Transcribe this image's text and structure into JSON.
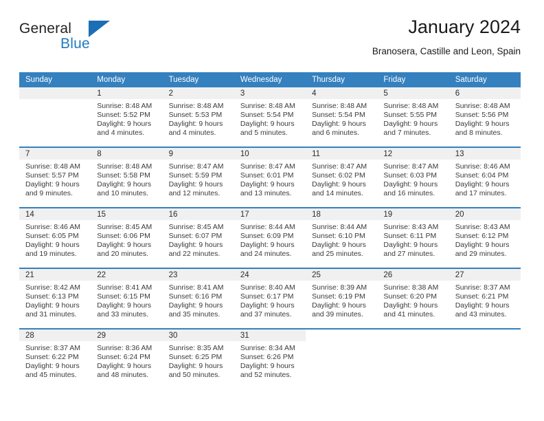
{
  "brand": {
    "name_part1": "General",
    "name_part2": "Blue",
    "accent_color": "#1a6fb5"
  },
  "header": {
    "title": "January 2024",
    "subtitle": "Branosera, Castille and Leon, Spain"
  },
  "theme": {
    "header_blue": "#3580be",
    "day_band_gray": "#f0f0f0",
    "text_color": "#3a3a3a"
  },
  "weekday_headers": [
    "Sunday",
    "Monday",
    "Tuesday",
    "Wednesday",
    "Thursday",
    "Friday",
    "Saturday"
  ],
  "weeks": [
    [
      {
        "day": "",
        "sunrise": "",
        "sunset": "",
        "daylight_line1": "",
        "daylight_line2": "",
        "empty": true
      },
      {
        "day": "1",
        "sunrise": "Sunrise: 8:48 AM",
        "sunset": "Sunset: 5:52 PM",
        "daylight_line1": "Daylight: 9 hours",
        "daylight_line2": "and 4 minutes."
      },
      {
        "day": "2",
        "sunrise": "Sunrise: 8:48 AM",
        "sunset": "Sunset: 5:53 PM",
        "daylight_line1": "Daylight: 9 hours",
        "daylight_line2": "and 4 minutes."
      },
      {
        "day": "3",
        "sunrise": "Sunrise: 8:48 AM",
        "sunset": "Sunset: 5:54 PM",
        "daylight_line1": "Daylight: 9 hours",
        "daylight_line2": "and 5 minutes."
      },
      {
        "day": "4",
        "sunrise": "Sunrise: 8:48 AM",
        "sunset": "Sunset: 5:54 PM",
        "daylight_line1": "Daylight: 9 hours",
        "daylight_line2": "and 6 minutes."
      },
      {
        "day": "5",
        "sunrise": "Sunrise: 8:48 AM",
        "sunset": "Sunset: 5:55 PM",
        "daylight_line1": "Daylight: 9 hours",
        "daylight_line2": "and 7 minutes."
      },
      {
        "day": "6",
        "sunrise": "Sunrise: 8:48 AM",
        "sunset": "Sunset: 5:56 PM",
        "daylight_line1": "Daylight: 9 hours",
        "daylight_line2": "and 8 minutes."
      }
    ],
    [
      {
        "day": "7",
        "sunrise": "Sunrise: 8:48 AM",
        "sunset": "Sunset: 5:57 PM",
        "daylight_line1": "Daylight: 9 hours",
        "daylight_line2": "and 9 minutes."
      },
      {
        "day": "8",
        "sunrise": "Sunrise: 8:48 AM",
        "sunset": "Sunset: 5:58 PM",
        "daylight_line1": "Daylight: 9 hours",
        "daylight_line2": "and 10 minutes."
      },
      {
        "day": "9",
        "sunrise": "Sunrise: 8:47 AM",
        "sunset": "Sunset: 5:59 PM",
        "daylight_line1": "Daylight: 9 hours",
        "daylight_line2": "and 12 minutes."
      },
      {
        "day": "10",
        "sunrise": "Sunrise: 8:47 AM",
        "sunset": "Sunset: 6:01 PM",
        "daylight_line1": "Daylight: 9 hours",
        "daylight_line2": "and 13 minutes."
      },
      {
        "day": "11",
        "sunrise": "Sunrise: 8:47 AM",
        "sunset": "Sunset: 6:02 PM",
        "daylight_line1": "Daylight: 9 hours",
        "daylight_line2": "and 14 minutes."
      },
      {
        "day": "12",
        "sunrise": "Sunrise: 8:47 AM",
        "sunset": "Sunset: 6:03 PM",
        "daylight_line1": "Daylight: 9 hours",
        "daylight_line2": "and 16 minutes."
      },
      {
        "day": "13",
        "sunrise": "Sunrise: 8:46 AM",
        "sunset": "Sunset: 6:04 PM",
        "daylight_line1": "Daylight: 9 hours",
        "daylight_line2": "and 17 minutes."
      }
    ],
    [
      {
        "day": "14",
        "sunrise": "Sunrise: 8:46 AM",
        "sunset": "Sunset: 6:05 PM",
        "daylight_line1": "Daylight: 9 hours",
        "daylight_line2": "and 19 minutes."
      },
      {
        "day": "15",
        "sunrise": "Sunrise: 8:45 AM",
        "sunset": "Sunset: 6:06 PM",
        "daylight_line1": "Daylight: 9 hours",
        "daylight_line2": "and 20 minutes."
      },
      {
        "day": "16",
        "sunrise": "Sunrise: 8:45 AM",
        "sunset": "Sunset: 6:07 PM",
        "daylight_line1": "Daylight: 9 hours",
        "daylight_line2": "and 22 minutes."
      },
      {
        "day": "17",
        "sunrise": "Sunrise: 8:44 AM",
        "sunset": "Sunset: 6:09 PM",
        "daylight_line1": "Daylight: 9 hours",
        "daylight_line2": "and 24 minutes."
      },
      {
        "day": "18",
        "sunrise": "Sunrise: 8:44 AM",
        "sunset": "Sunset: 6:10 PM",
        "daylight_line1": "Daylight: 9 hours",
        "daylight_line2": "and 25 minutes."
      },
      {
        "day": "19",
        "sunrise": "Sunrise: 8:43 AM",
        "sunset": "Sunset: 6:11 PM",
        "daylight_line1": "Daylight: 9 hours",
        "daylight_line2": "and 27 minutes."
      },
      {
        "day": "20",
        "sunrise": "Sunrise: 8:43 AM",
        "sunset": "Sunset: 6:12 PM",
        "daylight_line1": "Daylight: 9 hours",
        "daylight_line2": "and 29 minutes."
      }
    ],
    [
      {
        "day": "21",
        "sunrise": "Sunrise: 8:42 AM",
        "sunset": "Sunset: 6:13 PM",
        "daylight_line1": "Daylight: 9 hours",
        "daylight_line2": "and 31 minutes."
      },
      {
        "day": "22",
        "sunrise": "Sunrise: 8:41 AM",
        "sunset": "Sunset: 6:15 PM",
        "daylight_line1": "Daylight: 9 hours",
        "daylight_line2": "and 33 minutes."
      },
      {
        "day": "23",
        "sunrise": "Sunrise: 8:41 AM",
        "sunset": "Sunset: 6:16 PM",
        "daylight_line1": "Daylight: 9 hours",
        "daylight_line2": "and 35 minutes."
      },
      {
        "day": "24",
        "sunrise": "Sunrise: 8:40 AM",
        "sunset": "Sunset: 6:17 PM",
        "daylight_line1": "Daylight: 9 hours",
        "daylight_line2": "and 37 minutes."
      },
      {
        "day": "25",
        "sunrise": "Sunrise: 8:39 AM",
        "sunset": "Sunset: 6:19 PM",
        "daylight_line1": "Daylight: 9 hours",
        "daylight_line2": "and 39 minutes."
      },
      {
        "day": "26",
        "sunrise": "Sunrise: 8:38 AM",
        "sunset": "Sunset: 6:20 PM",
        "daylight_line1": "Daylight: 9 hours",
        "daylight_line2": "and 41 minutes."
      },
      {
        "day": "27",
        "sunrise": "Sunrise: 8:37 AM",
        "sunset": "Sunset: 6:21 PM",
        "daylight_line1": "Daylight: 9 hours",
        "daylight_line2": "and 43 minutes."
      }
    ],
    [
      {
        "day": "28",
        "sunrise": "Sunrise: 8:37 AM",
        "sunset": "Sunset: 6:22 PM",
        "daylight_line1": "Daylight: 9 hours",
        "daylight_line2": "and 45 minutes."
      },
      {
        "day": "29",
        "sunrise": "Sunrise: 8:36 AM",
        "sunset": "Sunset: 6:24 PM",
        "daylight_line1": "Daylight: 9 hours",
        "daylight_line2": "and 48 minutes."
      },
      {
        "day": "30",
        "sunrise": "Sunrise: 8:35 AM",
        "sunset": "Sunset: 6:25 PM",
        "daylight_line1": "Daylight: 9 hours",
        "daylight_line2": "and 50 minutes."
      },
      {
        "day": "31",
        "sunrise": "Sunrise: 8:34 AM",
        "sunset": "Sunset: 6:26 PM",
        "daylight_line1": "Daylight: 9 hours",
        "daylight_line2": "and 52 minutes."
      },
      {
        "day": "",
        "sunrise": "",
        "sunset": "",
        "daylight_line1": "",
        "daylight_line2": "",
        "empty": true,
        "blank": true
      },
      {
        "day": "",
        "sunrise": "",
        "sunset": "",
        "daylight_line1": "",
        "daylight_line2": "",
        "empty": true,
        "blank": true
      },
      {
        "day": "",
        "sunrise": "",
        "sunset": "",
        "daylight_line1": "",
        "daylight_line2": "",
        "empty": true,
        "blank": true
      }
    ]
  ]
}
